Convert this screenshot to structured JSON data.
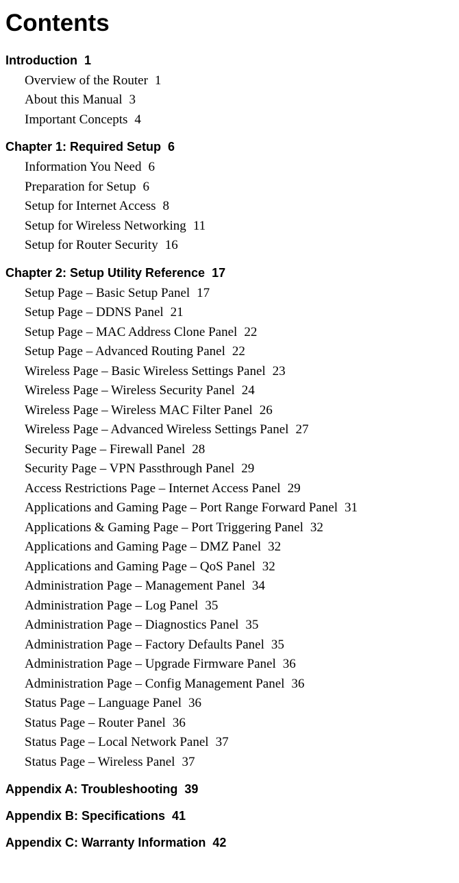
{
  "title": "Contents",
  "sections": [
    {
      "title": "Introduction",
      "page": "1",
      "entries": [
        {
          "title": "Overview of the Router",
          "page": "1"
        },
        {
          "title": "About this Manual",
          "page": "3"
        },
        {
          "title": "Important Concepts",
          "page": "4"
        }
      ]
    },
    {
      "title": "Chapter 1: Required Setup",
      "page": "6",
      "entries": [
        {
          "title": "Information You Need",
          "page": "6"
        },
        {
          "title": "Preparation for Setup",
          "page": "6"
        },
        {
          "title": "Setup for Internet Access",
          "page": "8"
        },
        {
          "title": "Setup for Wireless Networking",
          "page": "11"
        },
        {
          "title": "Setup for Router Security",
          "page": "16"
        }
      ]
    },
    {
      "title": "Chapter 2: Setup Utility Reference",
      "page": "17",
      "entries": [
        {
          "title": "Setup Page – Basic Setup Panel",
          "page": "17"
        },
        {
          "title": "Setup Page – DDNS Panel",
          "page": "21"
        },
        {
          "title": "Setup Page – MAC Address Clone Panel",
          "page": "22"
        },
        {
          "title": "Setup Page – Advanced Routing Panel",
          "page": "22"
        },
        {
          "title": "Wireless Page – Basic Wireless Settings Panel",
          "page": "23"
        },
        {
          "title": "Wireless Page – Wireless Security Panel",
          "page": "24"
        },
        {
          "title": "Wireless Page – Wireless MAC Filter Panel",
          "page": "26"
        },
        {
          "title": "Wireless Page – Advanced Wireless Settings Panel",
          "page": "27"
        },
        {
          "title": "Security Page – Firewall Panel",
          "page": "28"
        },
        {
          "title": "Security Page – VPN Passthrough Panel",
          "page": "29"
        },
        {
          "title": "Access Restrictions Page – Internet Access Panel",
          "page": "29"
        },
        {
          "title": "Applications and Gaming Page – Port Range Forward Panel",
          "page": "31"
        },
        {
          "title": "Applications & Gaming Page – Port Triggering Panel",
          "page": "32"
        },
        {
          "title": "Applications and Gaming Page – DMZ Panel",
          "page": "32"
        },
        {
          "title": "Applications and Gaming Page – QoS Panel",
          "page": "32"
        },
        {
          "title": "Administration Page – Management Panel",
          "page": "34"
        },
        {
          "title": "Administration Page – Log Panel",
          "page": "35"
        },
        {
          "title": "Administration Page – Diagnostics Panel",
          "page": "35"
        },
        {
          "title": "Administration Page – Factory Defaults Panel",
          "page": "35"
        },
        {
          "title": "Administration Page – Upgrade Firmware Panel",
          "page": "36"
        },
        {
          "title": "Administration Page – Config Management Panel",
          "page": "36"
        },
        {
          "title": "Status Page – Language Panel",
          "page": "36"
        },
        {
          "title": "Status Page – Router Panel",
          "page": "36"
        },
        {
          "title": "Status Page – Local Network Panel",
          "page": "37"
        },
        {
          "title": "Status Page – Wireless Panel",
          "page": "37"
        }
      ]
    },
    {
      "title": "Appendix A: Troubleshooting",
      "page": "39",
      "entries": []
    },
    {
      "title": "Appendix B: Specifications",
      "page": "41",
      "entries": []
    },
    {
      "title": "Appendix C: Warranty Information",
      "page": "42",
      "entries": []
    }
  ]
}
